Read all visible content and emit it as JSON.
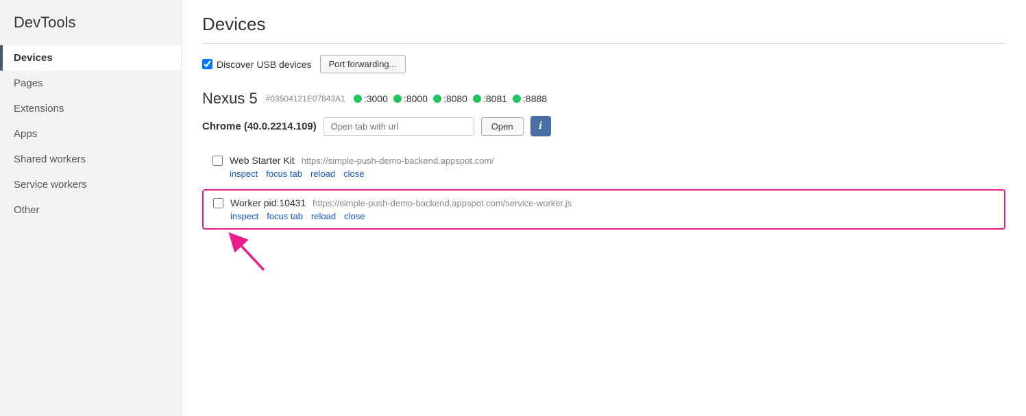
{
  "sidebar": {
    "title": "DevTools",
    "items": [
      {
        "label": "Devices",
        "active": true
      },
      {
        "label": "Pages",
        "active": false
      },
      {
        "label": "Extensions",
        "active": false
      },
      {
        "label": "Apps",
        "active": false
      },
      {
        "label": "Shared workers",
        "active": false
      },
      {
        "label": "Service workers",
        "active": false
      },
      {
        "label": "Other",
        "active": false
      }
    ]
  },
  "main": {
    "page_title": "Devices",
    "toolbar": {
      "discover_usb_label": "Discover USB devices",
      "port_forwarding_label": "Port forwarding..."
    },
    "device": {
      "name": "Nexus 5",
      "id": "#03504121E07843A1",
      "ports": [
        ":3000",
        ":8000",
        ":8080",
        ":8081",
        ":8888"
      ],
      "browser": "Chrome (40.0.2214.109)",
      "url_placeholder": "Open tab with url",
      "open_label": "Open",
      "info_label": "i"
    },
    "tabs": [
      {
        "title": "Web Starter Kit",
        "url": "https://simple-push-demo-backend.appspot.com/",
        "actions": [
          "inspect",
          "focus tab",
          "reload",
          "close"
        ],
        "highlighted": false
      },
      {
        "title": "Worker pid:10431",
        "url": "https://simple-push-demo-backend.appspot.com/service-worker.js",
        "actions": [
          "inspect",
          "focus tab",
          "reload",
          "close"
        ],
        "highlighted": true
      }
    ]
  }
}
